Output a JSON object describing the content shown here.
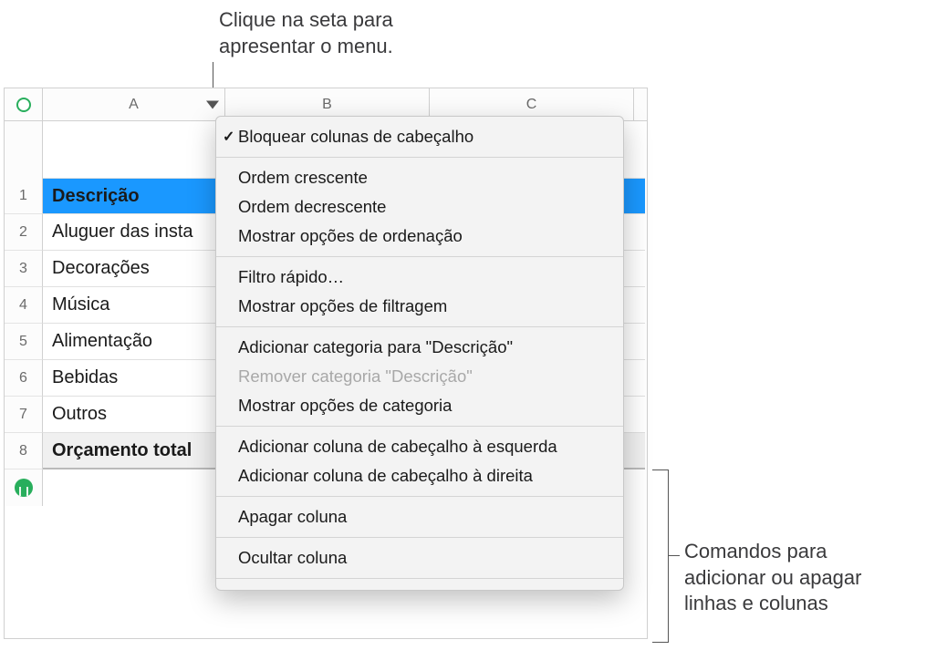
{
  "annotations": {
    "top": "Clique na seta para\napresentar o menu.",
    "right": "Comandos para\nadicionar ou apagar\nlinhas e colunas"
  },
  "columns": [
    "A",
    "B",
    "C"
  ],
  "row_numbers": [
    "1",
    "2",
    "3",
    "4",
    "5",
    "6",
    "7",
    "8"
  ],
  "table": {
    "header_label": "Descrição",
    "rows": [
      "Aluguer das insta",
      "Decorações",
      "Música",
      "Alimentação",
      "Bebidas",
      "Outros"
    ],
    "footer_label": "Orçamento total"
  },
  "menu": {
    "freeze": "Bloquear colunas de cabeçalho",
    "sort_asc": "Ordem crescente",
    "sort_desc": "Ordem decrescente",
    "sort_options": "Mostrar opções de ordenação",
    "quick_filter": "Filtro rápido…",
    "filter_options": "Mostrar opções de filtragem",
    "add_category": "Adicionar categoria para \"Descrição\"",
    "remove_category": "Remover categoria \"Descrição\"",
    "category_options": "Mostrar opções de categoria",
    "add_col_left": "Adicionar coluna de cabeçalho à esquerda",
    "add_col_right": "Adicionar coluna de cabeçalho à direita",
    "delete_col": "Apagar coluna",
    "hide_col": "Ocultar coluna"
  }
}
